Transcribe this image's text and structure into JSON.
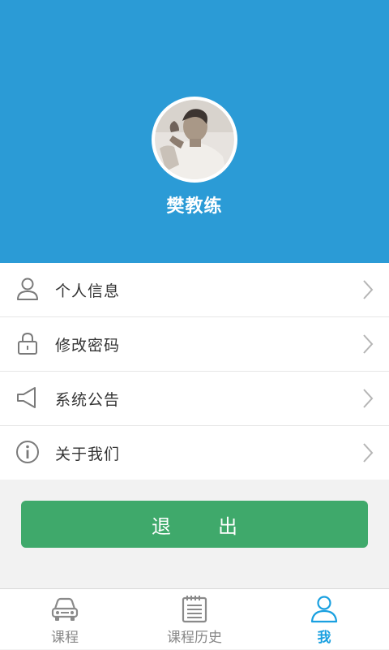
{
  "profile": {
    "name": "樊教练"
  },
  "menu": {
    "items": [
      {
        "label": "个人信息",
        "icon": "user-icon"
      },
      {
        "label": "修改密码",
        "icon": "lock-icon"
      },
      {
        "label": "系统公告",
        "icon": "speaker-icon"
      },
      {
        "label": "关于我们",
        "icon": "info-icon"
      }
    ]
  },
  "logout": {
    "label": "退出"
  },
  "tabbar": {
    "tabs": [
      {
        "label": "课程",
        "icon": "car-icon",
        "active": false
      },
      {
        "label": "课程历史",
        "icon": "notepad-icon",
        "active": false
      },
      {
        "label": "我",
        "icon": "user-icon",
        "active": true
      }
    ]
  },
  "colors": {
    "header": "#2b9bd6",
    "logout_button": "#3fa96b",
    "tab_active": "#1aa0e0",
    "tab_inactive": "#888888"
  }
}
